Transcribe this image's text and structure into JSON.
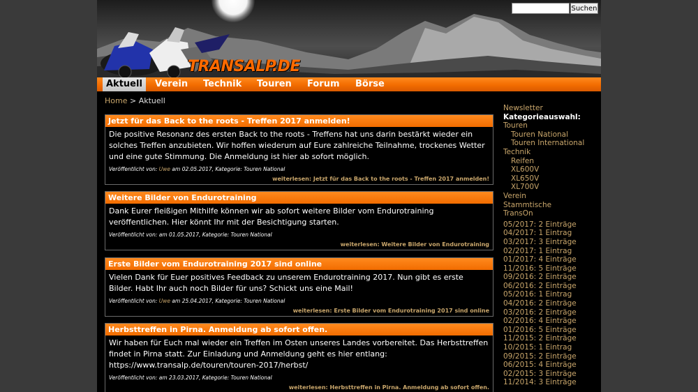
{
  "header": {
    "logo_text": "TRANSALP.DE",
    "search": {
      "placeholder": "",
      "button_label": "Suchen"
    }
  },
  "nav": [
    {
      "label": "Aktuell",
      "active": true
    },
    {
      "label": "Verein",
      "active": false
    },
    {
      "label": "Technik",
      "active": false
    },
    {
      "label": "Touren",
      "active": false
    },
    {
      "label": "Forum",
      "active": false
    },
    {
      "label": "Börse",
      "active": false
    }
  ],
  "breadcrumb": {
    "home": "Home",
    "separator": ">",
    "current": "Aktuell"
  },
  "posts": [
    {
      "title": "Jetzt für das Back to the roots - Treffen 2017 anmelden!",
      "body": "Die positive Resonanz des ersten Back to the roots - Treffens hat uns darin bestärkt wieder ein solches Treffen anzubieten. Wir hoffen wiederum auf Eure zahlreiche Teilnahme, trockenes Wetter und eine gute Stimmung. Die Anmeldung ist hier ab sofort möglich.",
      "meta_prefix": "Veröffentlicht von:",
      "author": "Uwe",
      "meta_suffix": "am 02.05.2017, Kategorie: Touren National",
      "more": "weiterlesen: Jetzt für das Back to the roots - Treffen 2017 anmelden!"
    },
    {
      "title": "Weitere Bilder von Endurotraining",
      "body": "Dank Eurer fleißigen Mithilfe können wir ab sofort weitere Bilder vom Endurotraining veröffentlichen. Hier könnt Ihr mit der Besichtigung starten.",
      "meta_prefix": "Veröffentlicht von:",
      "author": "",
      "meta_suffix": "am 01.05.2017, Kategorie: Touren National",
      "more": "weiterlesen: Weitere Bilder von Endurotraining"
    },
    {
      "title": "Erste Bilder vom Endurotraining 2017 sind online",
      "body": "Vielen Dank für Euer positives Feedback zu unserem Endurotraining 2017. Nun gibt es erste Bilder. Habt Ihr auch noch Bilder für uns? Schickt uns eine Mail!",
      "meta_prefix": "Veröffentlicht von:",
      "author": "Uwe",
      "meta_suffix": "am 25.04.2017, Kategorie: Touren National",
      "more": "weiterlesen: Erste Bilder vom Endurotraining 2017 sind online"
    },
    {
      "title": "Herbsttreffen in Pirna. Anmeldung ab sofort offen.",
      "body": "Wir haben für Euch mal wieder ein Treffen im Osten unseres Landes vorbereitet. Das Herbsttreffen findet in Pirna statt. Zur Einladung und Anmeldung geht es hier entlang: https://www.transalp.de/touren/touren-2017/herbst/",
      "meta_prefix": "Veröffentlicht von:",
      "author": "",
      "meta_suffix": "am 23.03.2017, Kategorie: Touren National",
      "more": "weiterlesen: Herbsttreffen in Pirna. Anmeldung ab sofort offen."
    }
  ],
  "sidebar": {
    "newsletter": "Newsletter",
    "categories_heading": "Kategorieauswahl:",
    "categories": [
      {
        "label": "Touren",
        "level": 0
      },
      {
        "label": "Touren National",
        "level": 1
      },
      {
        "label": "Touren International",
        "level": 1
      },
      {
        "label": "Technik",
        "level": 0
      },
      {
        "label": "Reifen",
        "level": 1
      },
      {
        "label": "XL600V",
        "level": 1
      },
      {
        "label": "XL650V",
        "level": 1
      },
      {
        "label": "XL700V",
        "level": 1
      },
      {
        "label": "Verein",
        "level": 0
      },
      {
        "label": "Stammtische",
        "level": 0
      },
      {
        "label": "TransOn",
        "level": 0
      }
    ],
    "archive": [
      "05/2017: 2 Einträge",
      "04/2017: 1 Eintrag",
      "03/2017: 3 Einträge",
      "02/2017: 1 Eintrag",
      "01/2017: 4 Einträge",
      "11/2016: 5 Einträge",
      "09/2016: 2 Einträge",
      "06/2016: 2 Einträge",
      "05/2016: 1 Eintrag",
      "04/2016: 2 Einträge",
      "03/2016: 2 Einträge",
      "02/2016: 4 Einträge",
      "01/2016: 5 Einträge",
      "11/2015: 2 Einträge",
      "10/2015: 1 Eintrag",
      "09/2015: 2 Einträge",
      "06/2015: 4 Einträge",
      "02/2015: 3 Einträge",
      "11/2014: 3 Einträge"
    ]
  },
  "colors": {
    "accent": "#f26c00",
    "link": "#c9a66b",
    "background": "#000000",
    "page_bg": "#3a3a3a"
  }
}
